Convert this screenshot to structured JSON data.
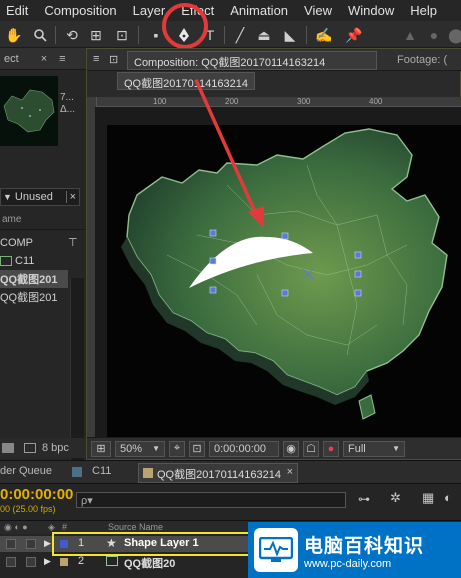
{
  "menu": [
    "Edit",
    "Composition",
    "Layer",
    "Effect",
    "Animation",
    "View",
    "Window",
    "Help"
  ],
  "toolbar": {
    "tools": [
      "hand-icon",
      "zoom-icon",
      "rotate-icon",
      "camera-icon",
      "pan-behind-icon",
      "rectangle-icon",
      "pen-icon",
      "text-icon",
      "brush-icon",
      "clone-stamp-icon",
      "eraser-icon",
      "roto-brush-icon",
      "puppet-pin-icon"
    ],
    "highlighted_tool": "pen-icon"
  },
  "project_panel": {
    "tab_label": "ect",
    "thumb_info": [
      "7...",
      "Δ..."
    ],
    "search_value": "Unused",
    "column_header": "ame",
    "items": [
      {
        "label": "COMP",
        "type": "folder"
      },
      {
        "label": "C11",
        "type": "comp"
      },
      {
        "label": "QQ截图201",
        "type": "comp",
        "selected": true
      },
      {
        "label": "QQ截图201",
        "type": "footage"
      }
    ],
    "bpc": "8 bpc"
  },
  "comp_panel": {
    "tab_label": "Composition: QQ截图20170114163214",
    "footage_tab": "Footage: (",
    "breadcrumb": "QQ截图20170114163214",
    "ruler_ticks": [
      "100",
      "200",
      "300",
      "400"
    ],
    "zoom": "50%",
    "timecode": "0:00:00:00",
    "resolution": "Full"
  },
  "timeline": {
    "tabs": [
      "der Queue",
      "C11",
      "QQ截图20170114163214"
    ],
    "timecode": "0:00:00:00",
    "fps": "00 (25.00 fps)",
    "search_placeholder": "ρ▾",
    "column_source": "Source Name",
    "layers": [
      {
        "num": "1",
        "name": "Shape Layer 1",
        "selected": true
      },
      {
        "num": "2",
        "name": "QQ截图20"
      }
    ]
  },
  "watermark": {
    "title": "电脑百科知识",
    "url": "www.pc-daily.com"
  },
  "colors": {
    "accent": "#e2b100",
    "annotation_red": "#e23a3a",
    "highlight_yellow": "#f2e52a",
    "map_green": "#3f6a3c"
  }
}
